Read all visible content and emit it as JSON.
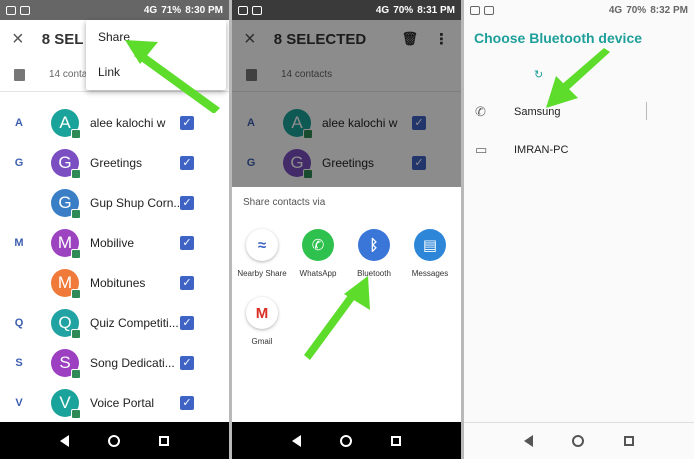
{
  "colors": {
    "accent": "#3f63c4",
    "bt_teal": "#1e9f9a",
    "arrow": "#5ddc2c"
  },
  "panel1": {
    "status": {
      "network": "4G",
      "signal": "4G",
      "battery": "71%",
      "time": "8:30 PM"
    },
    "toolbar": {
      "close_icon": "×",
      "title": "8 SEL"
    },
    "subbar": {
      "text": "14 conta"
    },
    "menu": {
      "items": [
        "Share",
        "Link"
      ]
    },
    "contacts": [
      {
        "letter": "A",
        "initial": "A",
        "name": "alee kalochi w",
        "color": "#1aa39a"
      },
      {
        "letter": "G",
        "initial": "G",
        "name": "Greetings",
        "color": "#7b4fc2"
      },
      {
        "letter": "",
        "initial": "G",
        "name": "Gup Shup Corn...",
        "color": "#3a7fc6"
      },
      {
        "letter": "M",
        "initial": "M",
        "name": "Mobilive",
        "color": "#9c44c0"
      },
      {
        "letter": "",
        "initial": "M",
        "name": "Mobitunes",
        "color": "#f07a3a"
      },
      {
        "letter": "Q",
        "initial": "Q",
        "name": "Quiz Competiti...",
        "color": "#21a3a3"
      },
      {
        "letter": "S",
        "initial": "S",
        "name": "Song Dedicati...",
        "color": "#9c3fc0"
      },
      {
        "letter": "V",
        "initial": "V",
        "name": "Voice Portal",
        "color": "#1aa39a"
      }
    ]
  },
  "panel2": {
    "status": {
      "network": "4G",
      "battery": "70%",
      "time": "8:31 PM"
    },
    "toolbar": {
      "close_icon": "×",
      "title": "8 SELECTED",
      "delete_icon": "🗑",
      "more_icon": "⋮"
    },
    "subbar": {
      "text": "14 contacts"
    },
    "contacts": [
      {
        "letter": "A",
        "initial": "A",
        "name": "alee kalochi w",
        "color": "#1aa39a"
      },
      {
        "letter": "G",
        "initial": "G",
        "name": "Greetings",
        "color": "#7b4fc2"
      }
    ],
    "sheet": {
      "title": "Share contacts via",
      "apps": [
        {
          "label": "Nearby Share",
          "glyph": "≈",
          "color": "#ffffff",
          "fg": "#3f63c4",
          "icon": "nearby-share-icon"
        },
        {
          "label": "WhatsApp",
          "glyph": "✆",
          "color": "#2fc14d",
          "fg": "#ffffff",
          "icon": "whatsapp-icon"
        },
        {
          "label": "Bluetooth",
          "glyph": "ᛒ",
          "color": "#3a76d8",
          "fg": "#ffffff",
          "icon": "bluetooth-icon"
        },
        {
          "label": "Messages",
          "glyph": "▤",
          "color": "#2d86d8",
          "fg": "#ffffff",
          "icon": "messages-icon"
        },
        {
          "label": "Gmail",
          "glyph": "M",
          "color": "#ffffff",
          "fg": "#d93025",
          "icon": "gmail-icon"
        }
      ]
    }
  },
  "panel3": {
    "status": {
      "network": "4G",
      "battery": "70%",
      "time": "8:32 PM"
    },
    "title": "Choose Bluetooth device",
    "refresh_icon": "↻",
    "devices": [
      {
        "name": "Samsung",
        "glyph": "✆",
        "icon": "phone-icon"
      },
      {
        "name": "IMRAN-PC",
        "glyph": "▭",
        "icon": "laptop-icon"
      }
    ]
  }
}
